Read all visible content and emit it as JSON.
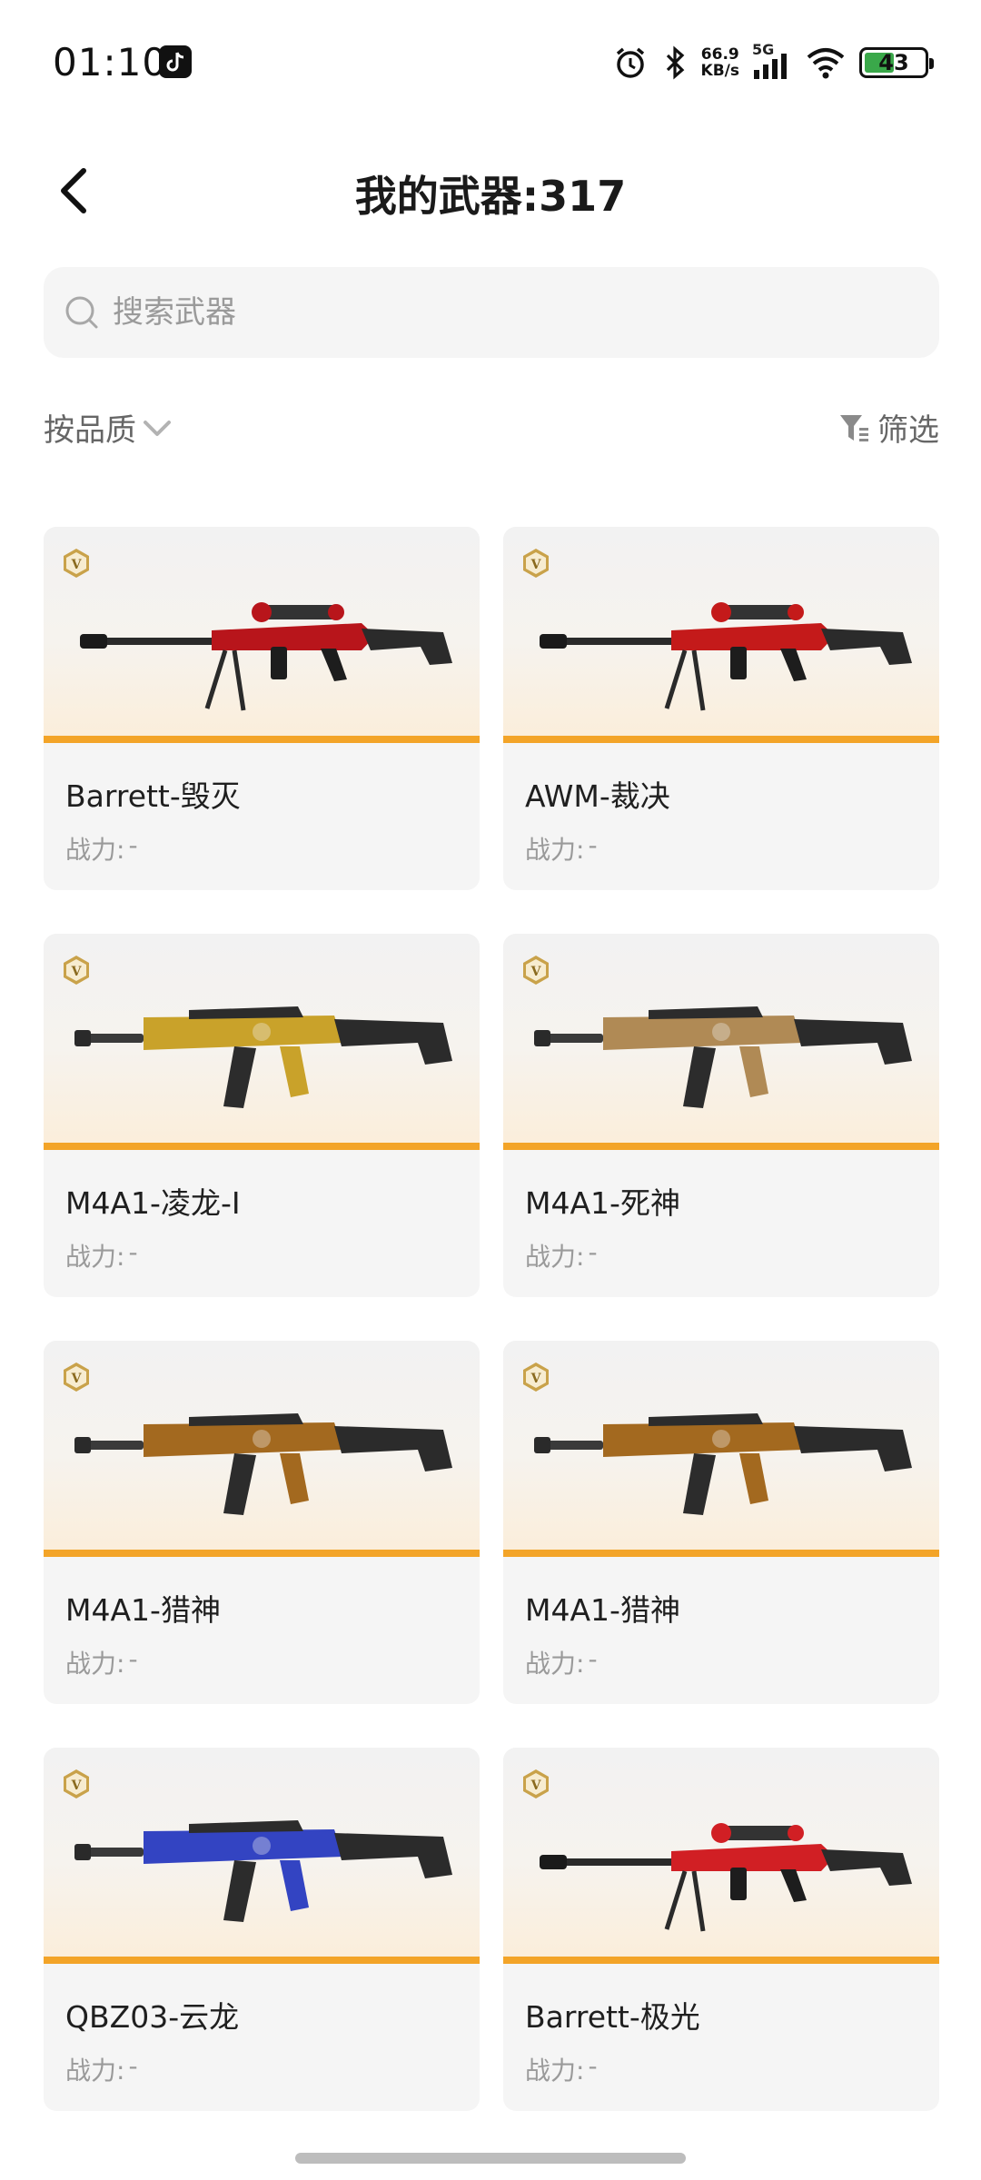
{
  "status_bar": {
    "time": "01:10",
    "net_speed_value": "66.9",
    "net_speed_unit": "KB/s",
    "network": "5G",
    "battery": "43"
  },
  "header": {
    "title": "我的武器:317"
  },
  "search": {
    "placeholder": "搜索武器",
    "value": ""
  },
  "filters": {
    "sort_label": "按品质",
    "filter_label": "筛选"
  },
  "weapons": [
    {
      "name": "Barrett-毁灭",
      "power_label": "战力:",
      "power_value": "-",
      "grade": "V",
      "color": "#b8151b",
      "icon": "sniper-rifle-icon"
    },
    {
      "name": "AWM-裁决",
      "power_label": "战力:",
      "power_value": "-",
      "grade": "V",
      "color": "#c41a1a",
      "icon": "sniper-rifle-icon"
    },
    {
      "name": "M4A1-凌龙-I",
      "power_label": "战力:",
      "power_value": "-",
      "grade": "V",
      "color": "#c9a22a",
      "icon": "assault-rifle-icon"
    },
    {
      "name": "M4A1-死神",
      "power_label": "战力:",
      "power_value": "-",
      "grade": "V",
      "color": "#b08a55",
      "icon": "assault-rifle-icon"
    },
    {
      "name": "M4A1-猎神",
      "power_label": "战力:",
      "power_value": "-",
      "grade": "V",
      "color": "#a3691f",
      "icon": "assault-rifle-icon"
    },
    {
      "name": "M4A1-猎神",
      "power_label": "战力:",
      "power_value": "-",
      "grade": "V",
      "color": "#a3691f",
      "icon": "assault-rifle-icon"
    },
    {
      "name": "QBZ03-云龙",
      "power_label": "战力:",
      "power_value": "-",
      "grade": "V",
      "color": "#3344c2",
      "icon": "assault-rifle-icon"
    },
    {
      "name": "Barrett-极光",
      "power_label": "战力:",
      "power_value": "-",
      "grade": "V",
      "color": "#d11f24",
      "icon": "sniper-rifle-icon"
    }
  ],
  "colors": {
    "accent_line": "#f3a428",
    "badge_gold": "#c9a24a"
  }
}
